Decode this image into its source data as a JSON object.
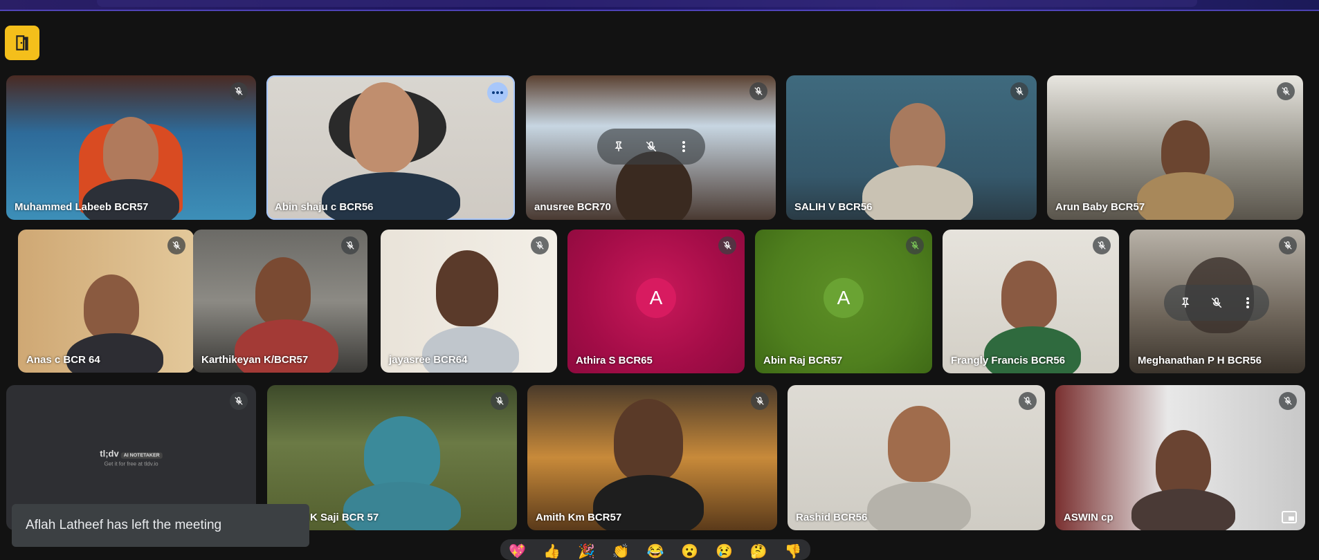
{
  "colors": {
    "accent": "#a8c7fa",
    "exit": "#f4bf1b",
    "athira": "#b5104e",
    "abinraj": "#4f7f1e"
  },
  "participants": [
    {
      "name": "Muhammed Labeeb BCR57"
    },
    {
      "name": "Abin shaju c BCR56"
    },
    {
      "name": "anusree BCR70"
    },
    {
      "name": "SALIH V BCR56"
    },
    {
      "name": "Arun Baby BCR57"
    },
    {
      "name": "Anas c BCR 64"
    },
    {
      "name": "Karthikeyan K/BCR57"
    },
    {
      "name": "jayasree BCR64"
    },
    {
      "name": "Athira S BCR65",
      "initial": "A"
    },
    {
      "name": "Abin Raj BCR57",
      "initial": "A"
    },
    {
      "name": "Frangly Francis BCR56"
    },
    {
      "name": "Meghanathan P H BCR56"
    },
    {
      "name": "tl;dv AI Notetaker"
    },
    {
      "name": "K Saji BCR 57"
    },
    {
      "name": "Amith Km BCR57"
    },
    {
      "name": "Rashid BCR56"
    },
    {
      "name": "ASWIN cp"
    }
  ],
  "tldv": {
    "logo": "tl;dv",
    "badge": "AI NOTETAKER",
    "sub": "Get it for free at tldv.io"
  },
  "toast": {
    "message": "Aflah Latheef has left the meeting"
  },
  "reactions": [
    "💖",
    "👍",
    "🎉",
    "👏",
    "😂",
    "😮",
    "😢",
    "🤔",
    "👎"
  ],
  "icons": {
    "exit": "door-exit-icon",
    "mic_off": "mic-off-icon",
    "more": "more-options-icon",
    "pin": "pin-icon",
    "pip": "picture-in-picture-icon"
  }
}
